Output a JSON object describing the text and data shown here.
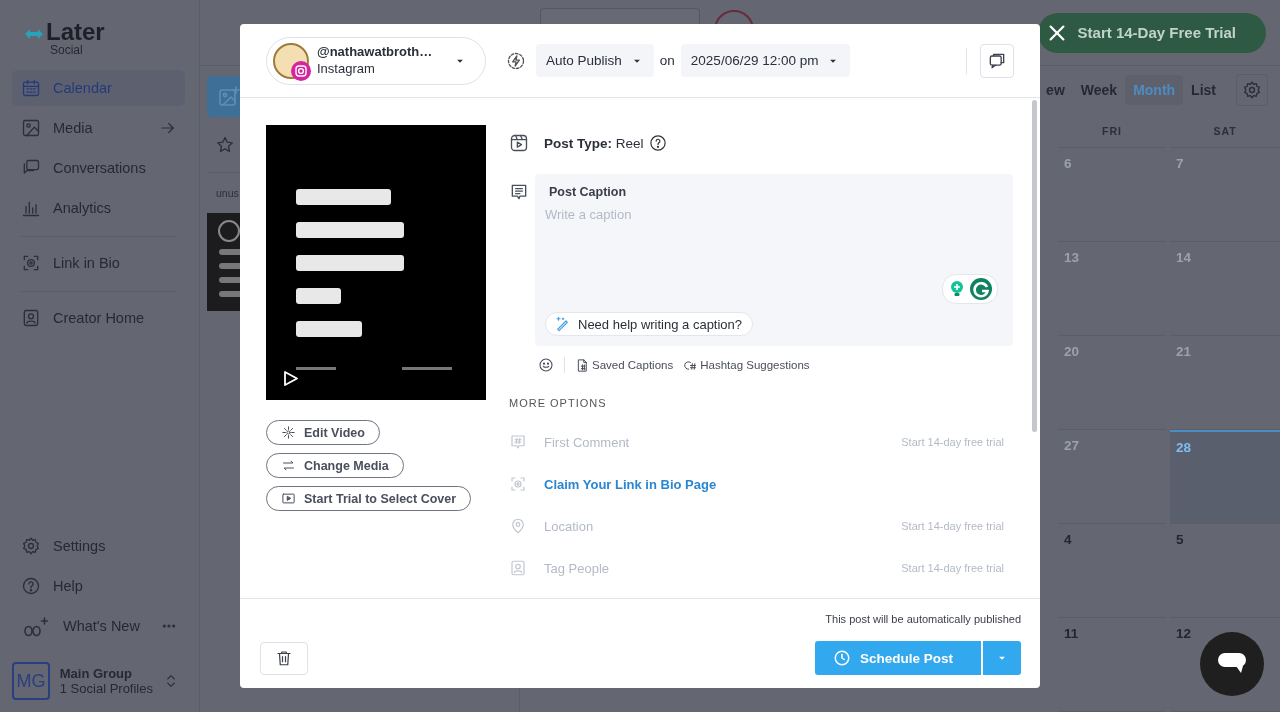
{
  "sidebar": {
    "logo": {
      "wordmark": "Later",
      "product": "Social"
    },
    "sections": [
      {
        "items": [
          {
            "label": "Calendar",
            "selected": true,
            "arrow": false
          },
          {
            "label": "Media",
            "selected": false,
            "arrow": true
          },
          {
            "label": "Conversations",
            "selected": false,
            "arrow": false
          },
          {
            "label": "Analytics",
            "selected": false,
            "arrow": false
          }
        ]
      },
      {
        "items": [
          {
            "label": "Link in Bio",
            "selected": false,
            "arrow": false
          }
        ]
      },
      {
        "items": [
          {
            "label": "Creator Home",
            "selected": false,
            "arrow": false
          }
        ]
      }
    ],
    "bottom_items": [
      {
        "label": "Settings",
        "more": false
      },
      {
        "label": "Help",
        "more": false
      },
      {
        "label": "What's New",
        "more": true
      }
    ],
    "account": {
      "initials": "MG",
      "name": "Main Group",
      "profiles": "1 Social Profiles"
    }
  },
  "media_panel": {
    "tag": "unus"
  },
  "top_bar": {
    "trial_button": "Start 14-Day Free Trial"
  },
  "calendar": {
    "views": [
      {
        "label": "ew",
        "selected": false
      },
      {
        "label": "Week",
        "selected": false
      },
      {
        "label": "Month",
        "selected": true
      },
      {
        "label": "List",
        "selected": false
      }
    ],
    "weekdays": [
      "FRI",
      "SAT"
    ],
    "weeks": [
      [
        {
          "day": "6",
          "kind": "past"
        },
        {
          "day": "7",
          "kind": "past"
        }
      ],
      [
        {
          "day": "13",
          "kind": "past"
        },
        {
          "day": "14",
          "kind": "past"
        }
      ],
      [
        {
          "day": "20",
          "kind": "past"
        },
        {
          "day": "21",
          "kind": "past"
        }
      ],
      [
        {
          "day": "27",
          "kind": "past"
        },
        {
          "day": "28",
          "kind": "today"
        }
      ],
      [
        {
          "day": "4",
          "kind": "future"
        },
        {
          "day": "5",
          "kind": "future"
        }
      ],
      [
        {
          "day": "11",
          "kind": "future"
        },
        {
          "day": "12",
          "kind": "future"
        }
      ]
    ]
  },
  "modal": {
    "account": {
      "handle": "@nathawatbroth…",
      "network": "Instagram"
    },
    "publish_mode": "Auto Publish",
    "on_label": "on",
    "datetime": "2025/06/29 12:00 pm",
    "media_actions": [
      "Edit Video",
      "Change Media",
      "Start Trial to Select Cover"
    ],
    "post_type": "**Post Type:** Reel",
    "caption": {
      "label": "Post Caption",
      "placeholder": "Write a caption",
      "help_button": "Need help writing a caption?"
    },
    "caption_tools": [
      "Saved Captions",
      "Hashtag Suggestions"
    ],
    "more_options": {
      "heading": "MORE OPTIONS",
      "items": [
        {
          "label": "First Comment",
          "kind": "locked",
          "note": "Start 14-day free trial"
        },
        {
          "label": "Claim Your Link in Bio Page",
          "kind": "link"
        },
        {
          "label": "Location",
          "kind": "locked",
          "note": "Start 14-day free trial"
        },
        {
          "label": "Tag People",
          "kind": "locked",
          "note": "Start 14-day free trial"
        }
      ]
    },
    "footer": {
      "notice": "This post will be automatically published",
      "schedule_button": "Schedule Post"
    }
  }
}
